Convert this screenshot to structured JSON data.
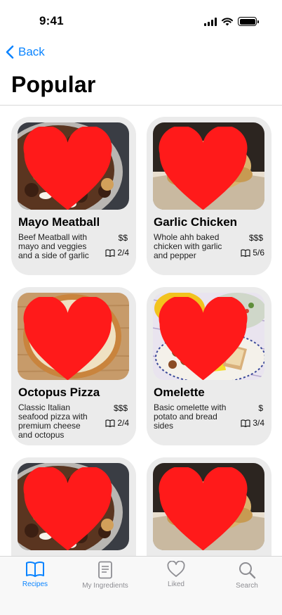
{
  "status_bar": {
    "time": "9:41"
  },
  "nav": {
    "back_label": "Back"
  },
  "page": {
    "title": "Popular"
  },
  "colors": {
    "accent": "#0a84ff",
    "heart": "#ff1a1a",
    "card_bg": "#ebebeb"
  },
  "recipes": [
    {
      "title": "Mayo Meatball",
      "description": "Beef Meatball with mayo and veggies and a side of garlic",
      "price": "$$",
      "steps": "2/4",
      "liked": true,
      "image": "meatball-dish"
    },
    {
      "title": "Garlic Chicken",
      "description": "Whole ahh baked chicken with garlic and pepper",
      "price": "$$$",
      "steps": "5/6",
      "liked": true,
      "image": "roast-chicken"
    },
    {
      "title": "Octopus Pizza",
      "description": "Classic Italian seafood pizza with premium cheese and octopus",
      "price": "$$$",
      "steps": "2/4",
      "liked": true,
      "image": "pizza"
    },
    {
      "title": "Omelette",
      "description": "Basic omelette with potato and bread sides",
      "price": "$",
      "steps": "3/4",
      "liked": true,
      "image": "omelette-plate"
    },
    {
      "title": "",
      "description": "",
      "price": "",
      "steps": "",
      "liked": true,
      "image": "meatball-dish"
    },
    {
      "title": "",
      "description": "",
      "price": "",
      "steps": "",
      "liked": true,
      "image": "roast-chicken"
    }
  ],
  "tabs": [
    {
      "label": "Recipes",
      "icon": "book-icon",
      "active": true
    },
    {
      "label": "My Ingredients",
      "icon": "document-icon",
      "active": false
    },
    {
      "label": "Liked",
      "icon": "heart-icon",
      "active": false
    },
    {
      "label": "Search",
      "icon": "search-icon",
      "active": false
    }
  ]
}
